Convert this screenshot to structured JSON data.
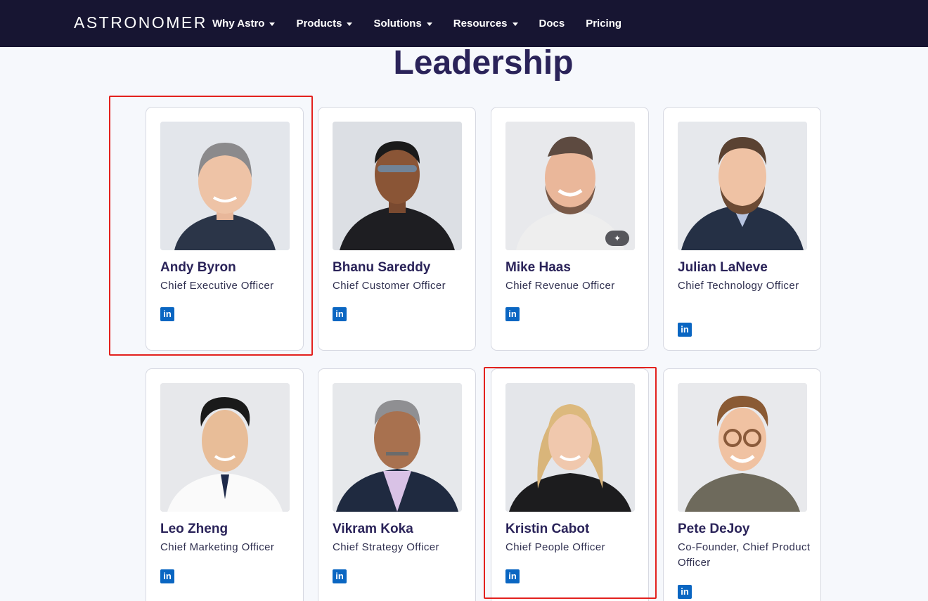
{
  "nav": {
    "logo": "ASTRONOMER",
    "items": [
      {
        "label": "Why Astro",
        "dropdown": true
      },
      {
        "label": "Products",
        "dropdown": true
      },
      {
        "label": "Solutions",
        "dropdown": true
      },
      {
        "label": "Resources",
        "dropdown": true
      },
      {
        "label": "Docs",
        "dropdown": false
      },
      {
        "label": "Pricing",
        "dropdown": false
      }
    ]
  },
  "section": {
    "title": "Leadership"
  },
  "leaders": [
    {
      "name": "Andy Byron",
      "role": "Chief Executive Officer",
      "highlighted": true
    },
    {
      "name": "Bhanu Sareddy",
      "role": "Chief Customer Officer"
    },
    {
      "name": "Mike Haas",
      "role": "Chief Revenue Officer",
      "badge_icon": "magic-wand-icon"
    },
    {
      "name": "Julian LaNeve",
      "role": "Chief Technology Officer"
    },
    {
      "name": "Leo Zheng",
      "role": "Chief Marketing Officer"
    },
    {
      "name": "Vikram Koka",
      "role": "Chief Strategy Officer"
    },
    {
      "name": "Kristin Cabot",
      "role": "Chief People Officer",
      "highlighted": true
    },
    {
      "name": "Pete DeJoy",
      "role": "Co-Founder, Chief Product Officer"
    }
  ],
  "linkedin": {
    "glyph": "in",
    "icon": "linkedin-icon"
  },
  "colors": {
    "nav_bg": "#171532",
    "heading": "#2a2359",
    "linkedin": "#0a66c2",
    "highlight": "#e3211e",
    "page_bg": "#f6f8fc"
  }
}
